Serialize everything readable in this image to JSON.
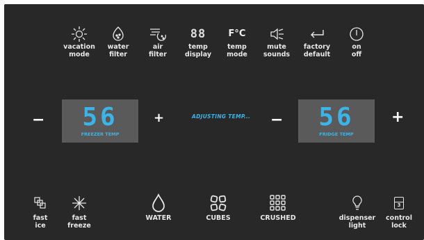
{
  "top_buttons": [
    {
      "label": "vacation\nmode",
      "icon": "sun-icon"
    },
    {
      "label": "water\nfilter",
      "icon": "water-filter-icon"
    },
    {
      "label": "air\nfilter",
      "icon": "air-filter-icon"
    },
    {
      "label": "temp\ndisplay",
      "icon": "digits-88-icon",
      "glyph": "88"
    },
    {
      "label": "temp\nmode",
      "icon": "fahrenheit-celsius-icon",
      "glyph": "F°C"
    },
    {
      "label": "mute\nsounds",
      "icon": "speaker-mute-icon"
    },
    {
      "label": "factory\ndefault",
      "icon": "return-arrow-icon"
    },
    {
      "label": "on\noff",
      "icon": "power-icon"
    }
  ],
  "freezer": {
    "value": "56",
    "caption": "FREEZER TEMP",
    "minus": "−",
    "plus": "+"
  },
  "fridge": {
    "value": "56",
    "caption": "FRIDGE TEMP",
    "minus": "−",
    "plus": "+"
  },
  "status": "ADJUSTING TEMP...",
  "bottom_buttons": [
    {
      "label": "fast\nice",
      "icon": "ice-cubes-icon"
    },
    {
      "label": "fast\nfreeze",
      "icon": "snowflake-icon"
    },
    {
      "label": "WATER",
      "icon": "water-drop-icon"
    },
    {
      "label": "CUBES",
      "icon": "cubes-icon"
    },
    {
      "label": "CRUSHED",
      "icon": "crushed-ice-icon"
    },
    {
      "label": "dispenser\nlight",
      "icon": "lightbulb-icon"
    },
    {
      "label": "control\nlock",
      "icon": "lock-icon",
      "glyph": "3"
    }
  ],
  "colors": {
    "panel": "#282828",
    "lcd_bg": "#5a5a5a",
    "accent": "#3cb4e8",
    "text": "#e8e8e8"
  }
}
